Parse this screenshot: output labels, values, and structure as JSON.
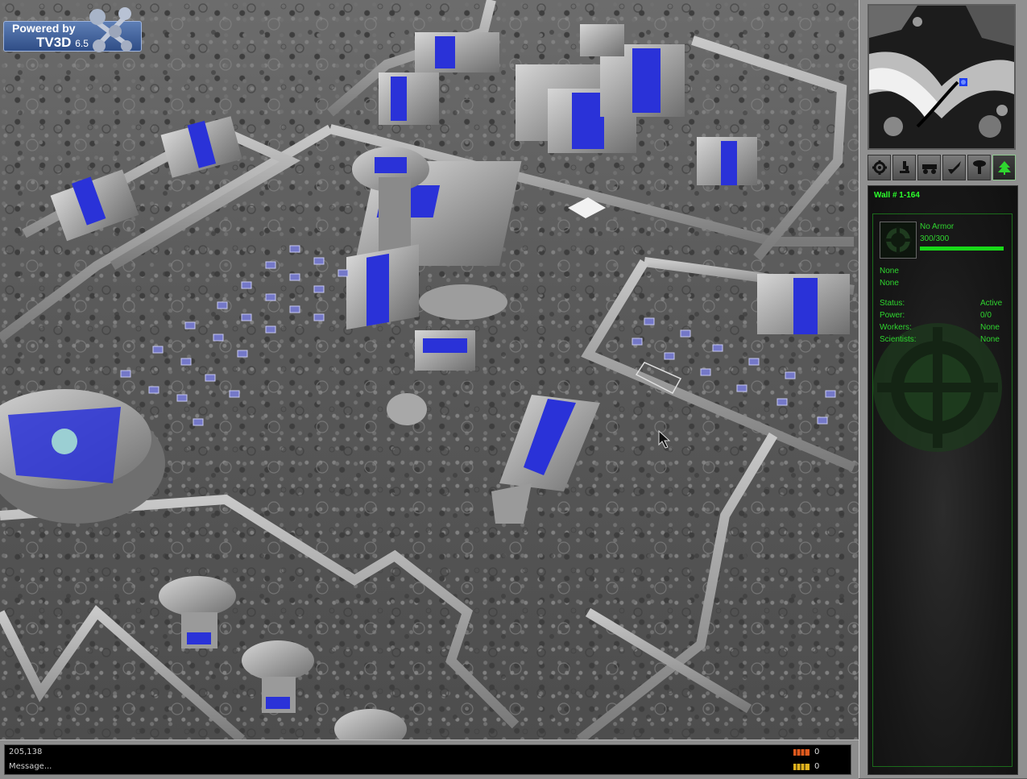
{
  "engine_badge": {
    "line1": "Powered by",
    "line2": "TV3D",
    "version": "6.5"
  },
  "console": {
    "coords": "205,138",
    "message": "Message...",
    "resources": [
      {
        "icon": "ore-icon",
        "color": "#e05a1e",
        "value": "0"
      },
      {
        "icon": "energy-icon",
        "color": "#e0b21e",
        "value": "0"
      }
    ]
  },
  "toolbar": {
    "buttons": [
      {
        "name": "settings",
        "icon": "gear-icon"
      },
      {
        "name": "research",
        "icon": "microscope-icon"
      },
      {
        "name": "vehicles",
        "icon": "vehicle-icon"
      },
      {
        "name": "military",
        "icon": "rocket-icon"
      },
      {
        "name": "structures",
        "icon": "tower-icon"
      },
      {
        "name": "environment",
        "icon": "tree-icon",
        "selected": true
      }
    ]
  },
  "selection": {
    "title": "Wall # 1-164",
    "armor": "No Armor",
    "hp": "300/300",
    "hp_fraction": 1.0,
    "line1": "None",
    "line2": "None",
    "stats": [
      {
        "label": "Status:",
        "value": "Active"
      },
      {
        "label": "Power:",
        "value": "0/0"
      },
      {
        "label": "Workers:",
        "value": "None"
      },
      {
        "label": "Scientists:",
        "value": "None"
      }
    ]
  },
  "colors": {
    "hud_green": "#2fd52f",
    "team_blue": "#2a32d8",
    "panel_gray": "#909090"
  }
}
